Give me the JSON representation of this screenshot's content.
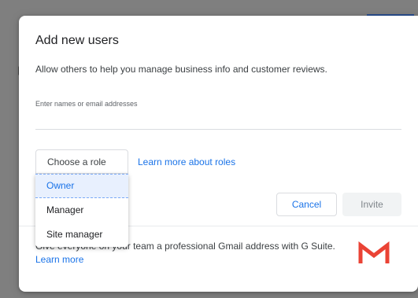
{
  "dialog": {
    "title": "Add new users",
    "subtitle": "Allow others to help you manage business info and customer reviews.",
    "names_field": {
      "placeholder": "Enter names or email addresses",
      "value": ""
    },
    "role_select": {
      "label": "Choose a role",
      "options": [
        "Owner",
        "Manager",
        "Site manager"
      ],
      "highlighted": "Owner"
    },
    "learn_roles_link": "Learn more about roles",
    "cancel_label": "Cancel",
    "invite_label": "Invite",
    "promo": {
      "text": "Give everyone on your team a professional Gmail address with G Suite.",
      "link": "Learn more",
      "logo_icon": "gmail-logo-icon"
    }
  },
  "colors": {
    "backdrop": "#7f7f7f",
    "link": "#1a73e8",
    "gmail_red": "#ea4335",
    "disabled_button_bg": "#f1f3f4",
    "highlight_bg": "#e8f0fe"
  }
}
